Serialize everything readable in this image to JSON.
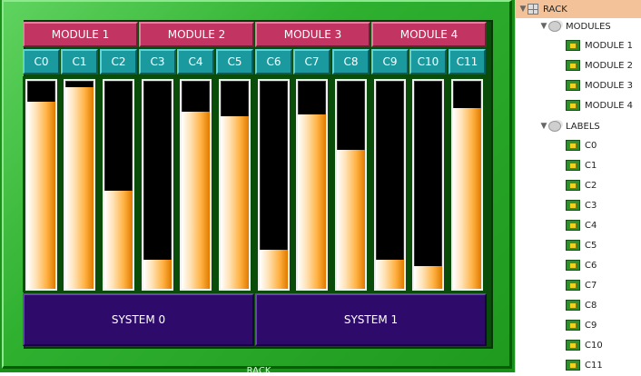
{
  "rack": {
    "caption": "RACK",
    "modules": [
      {
        "label": "MODULE 1"
      },
      {
        "label": "MODULE 2"
      },
      {
        "label": "MODULE 3"
      },
      {
        "label": "MODULE 4"
      }
    ],
    "channels": [
      {
        "label": "C0",
        "level": 0.9
      },
      {
        "label": "C1",
        "level": 0.97
      },
      {
        "label": "C2",
        "level": 0.47
      },
      {
        "label": "C3",
        "level": 0.14
      },
      {
        "label": "C4",
        "level": 0.85
      },
      {
        "label": "C5",
        "level": 0.83
      },
      {
        "label": "C6",
        "level": 0.19
      },
      {
        "label": "C7",
        "level": 0.84
      },
      {
        "label": "C8",
        "level": 0.67
      },
      {
        "label": "C9",
        "level": 0.14
      },
      {
        "label": "C10",
        "level": 0.11
      },
      {
        "label": "C11",
        "level": 0.87
      }
    ],
    "systems": [
      {
        "label": "SYSTEM 0"
      },
      {
        "label": "SYSTEM 1"
      }
    ]
  },
  "tree": {
    "root": {
      "label": "RACK",
      "icon": "rack-grid-icon"
    },
    "modules_group": {
      "label": "MODULES",
      "icon": "folder-icon"
    },
    "modules": [
      "MODULE 1",
      "MODULE 2",
      "MODULE 3",
      "MODULE 4"
    ],
    "labels_group": {
      "label": "LABELS",
      "icon": "folder-icon"
    },
    "labels": [
      "C0",
      "C1",
      "C2",
      "C3",
      "C4",
      "C5",
      "C6",
      "C7",
      "C8",
      "C9",
      "C10",
      "C11"
    ]
  }
}
